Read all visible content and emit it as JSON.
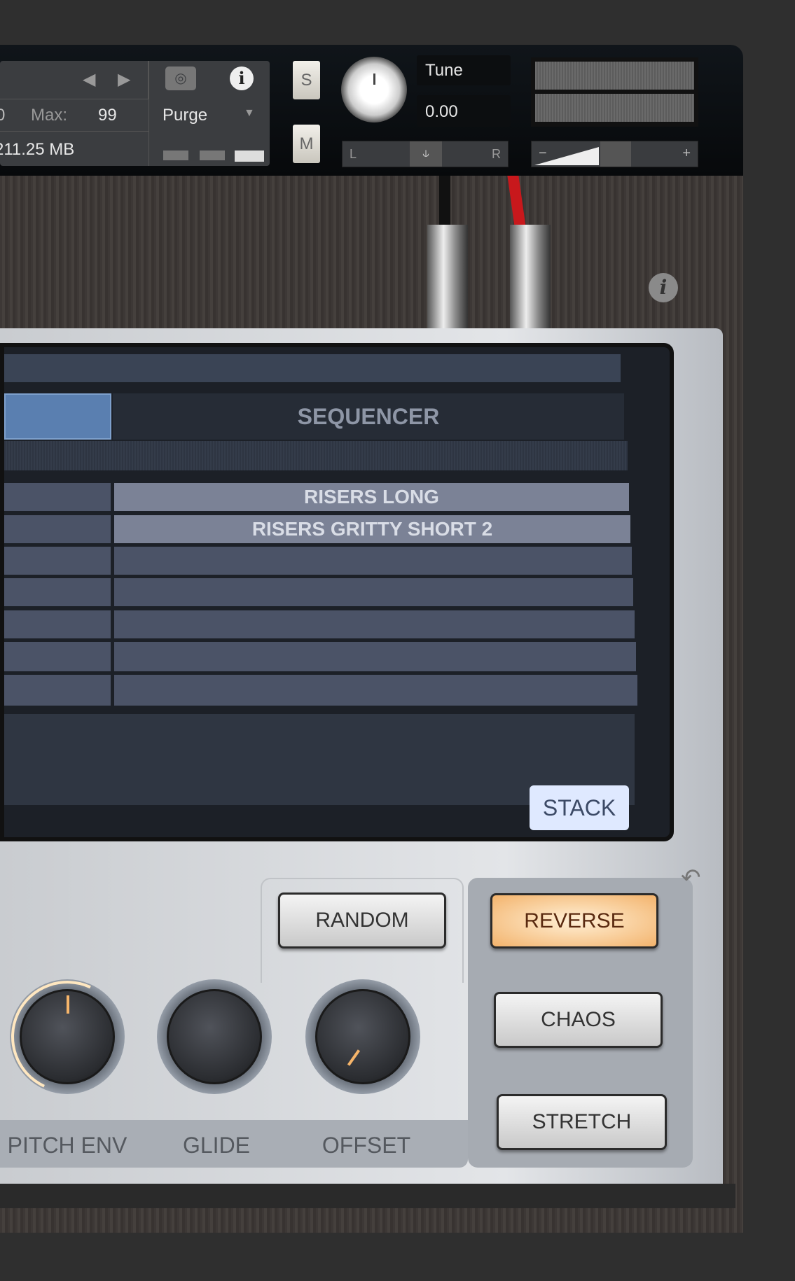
{
  "header": {
    "max_label": "Max:",
    "max_value": "99",
    "memory": "211.25 MB",
    "left_fragment": "0",
    "purge_label": "Purge",
    "solo_label": "S",
    "mute_label": "M",
    "tune_label": "Tune",
    "tune_value": "0.00",
    "pan_left": "L",
    "pan_right": "R",
    "volume_minus": "−",
    "volume_plus": "+"
  },
  "screen": {
    "tab_sequencer": "SEQUENCER",
    "rows": [
      "RISERS LONG",
      "RISERS GRITTY SHORT 2",
      "",
      "",
      "",
      "",
      ""
    ],
    "stack_label": "STACK"
  },
  "controls": {
    "random_label": "RANDOM",
    "reverse_label": "REVERSE",
    "chaos_label": "CHAOS",
    "stretch_label": "STRETCH",
    "reverse_active": true,
    "knobs": [
      {
        "label": "PITCH ENV"
      },
      {
        "label": "GLIDE"
      },
      {
        "label": "OFFSET"
      }
    ]
  },
  "colors": {
    "accent": "#f3b36c",
    "cable_red": "#c8181c",
    "tab_blue": "#5a7fb0"
  }
}
